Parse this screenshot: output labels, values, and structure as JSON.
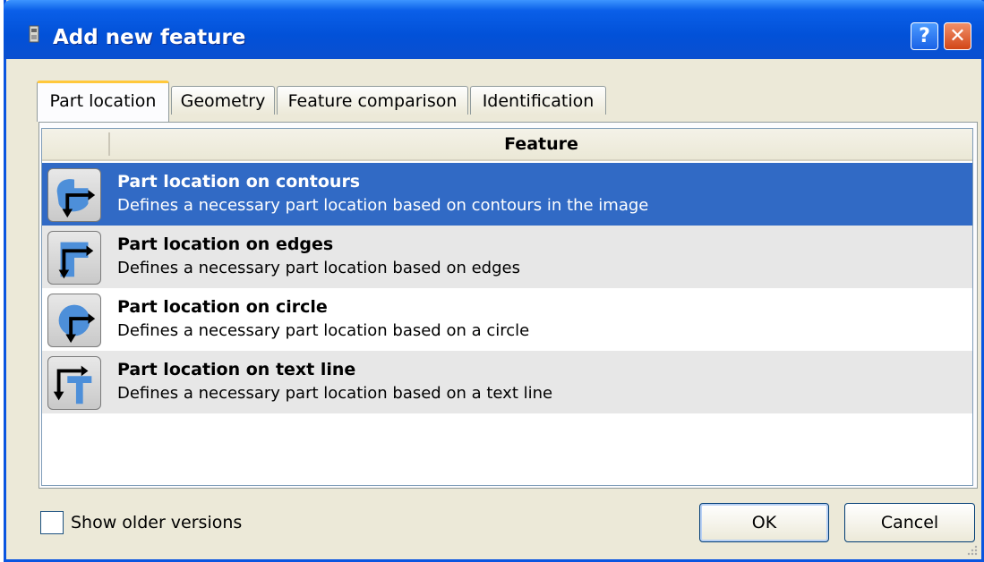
{
  "window": {
    "title": "Add new feature",
    "help_label": "?",
    "close_label": "✕"
  },
  "tabs": [
    {
      "label": "Part location",
      "active": true
    },
    {
      "label": "Geometry",
      "active": false
    },
    {
      "label": "Feature comparison",
      "active": false
    },
    {
      "label": "Identification",
      "active": false
    }
  ],
  "list": {
    "header": "Feature",
    "items": [
      {
        "title": "Part location on contours",
        "description": "Defines a necessary part location based on contours in the image",
        "icon": "contour-location-icon",
        "selected": true
      },
      {
        "title": "Part location on edges",
        "description": "Defines a necessary part location based on edges",
        "icon": "edge-location-icon",
        "selected": false
      },
      {
        "title": "Part location on circle",
        "description": "Defines a necessary part location based on a circle",
        "icon": "circle-location-icon",
        "selected": false
      },
      {
        "title": "Part location on text line",
        "description": "Defines a necessary part location based on a text line",
        "icon": "text-line-location-icon",
        "selected": false
      }
    ]
  },
  "footer": {
    "show_older_label": "Show older versions",
    "ok_label": "OK",
    "cancel_label": "Cancel"
  },
  "colors": {
    "titlebar": "#0251d8",
    "selection": "#316ac5",
    "active_tab_accent": "#ffc83c"
  }
}
